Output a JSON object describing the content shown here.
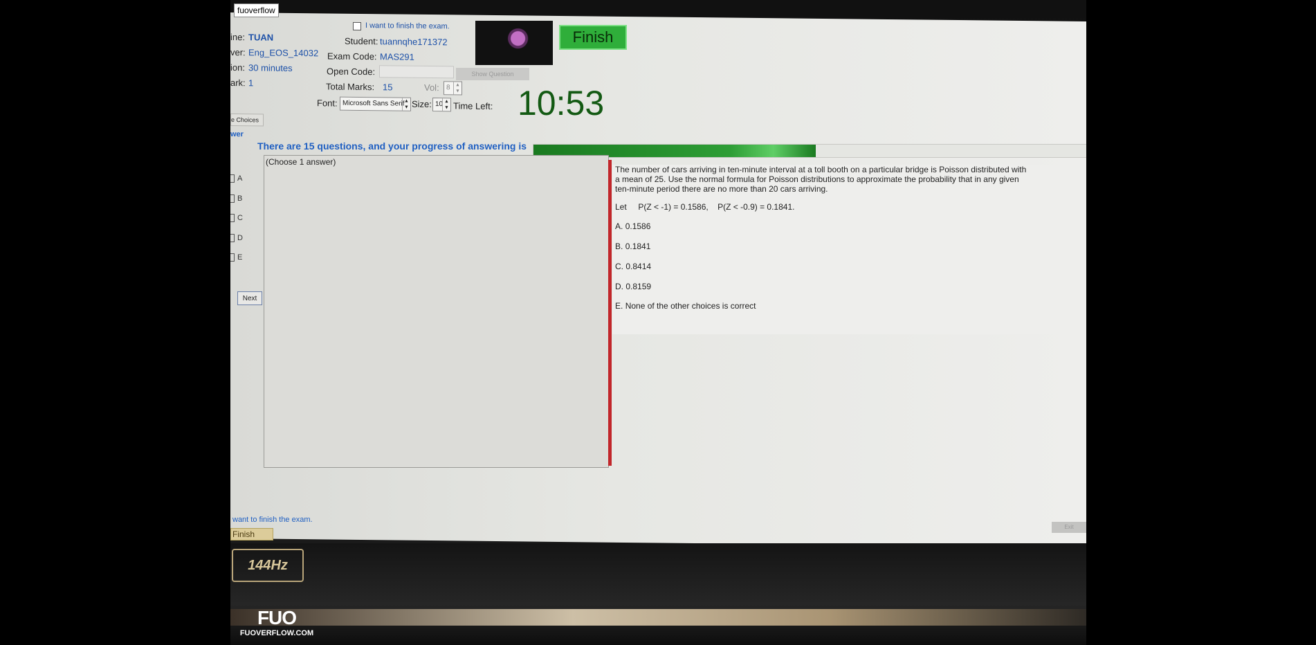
{
  "site_tag": "fuoverflow",
  "header": {
    "machine_label": "ine:",
    "machine_value": "TUAN",
    "server_label": "ver:",
    "server_value": "Eng_EOS_14032",
    "duration_label": "ion:",
    "duration_value": "30 minutes",
    "mark_label": "ark:",
    "mark_value": "1",
    "finish_checkbox_label": "I want to finish the exam.",
    "student_label": "Student:",
    "student_value": "tuannqhe171372",
    "exam_code_label": "Exam Code:",
    "exam_code_value": "MAS291",
    "open_code_label": "Open Code:",
    "open_code_value": "",
    "show_question_label": "Show Question",
    "total_marks_label": "Total Marks:",
    "total_marks_value": "15",
    "vol_label": "Vol:",
    "vol_value": "8",
    "font_label": "Font:",
    "font_value": "Microsoft Sans Serif",
    "size_label": "Size:",
    "size_value": "10",
    "time_left_label": "Time Left:",
    "time_left_value": "10:53",
    "finish_button": "Finish"
  },
  "tab_choices": "e Choices",
  "progress": {
    "text": "There are 15 questions, and your progress of answering is",
    "fraction": 0.51
  },
  "answer_panel": {
    "header": "wer",
    "choices": [
      "A",
      "B",
      "C",
      "D",
      "E"
    ],
    "instruction": "(Choose 1 answer)",
    "next_button": "Next"
  },
  "question": {
    "text": "The number of cars arriving in ten-minute interval at a toll booth on a particular bridge is Poisson distributed with a mean of 25. Use the normal formula for Poisson distributions to approximate the probability that in any given ten-minute period there are no more than 20 cars arriving.",
    "let_line": "Let     P(Z < -1) = 0.1586,    P(Z < -0.9) = 0.1841.",
    "options": [
      {
        "letter": "A.",
        "text": "0.1586"
      },
      {
        "letter": "B.",
        "text": "0.1841"
      },
      {
        "letter": "C.",
        "text": "0.8414"
      },
      {
        "letter": "D.",
        "text": "0.8159"
      },
      {
        "letter": "E.",
        "text": "None of the other choices is correct"
      }
    ]
  },
  "footer": {
    "finish_text": "want to finish the exam.",
    "finish_button": "Finish",
    "exit_button": "Exit"
  },
  "laptop": {
    "refresh_badge": "144Hz"
  },
  "watermark": {
    "logo": "FUO",
    "site": "FUOVERFLOW.COM"
  }
}
